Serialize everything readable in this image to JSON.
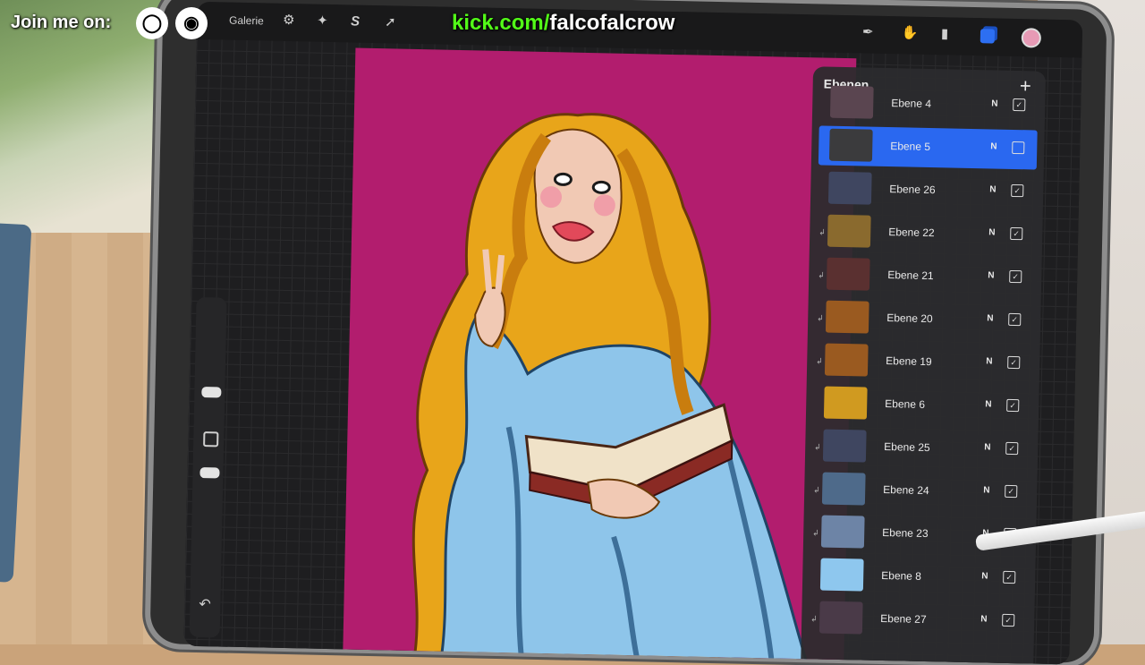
{
  "overlay": {
    "join_text": "Join me on:",
    "instagram_icon": "instagram-icon",
    "discord_icon": "discord-icon",
    "kick_domain": "kick.com/",
    "kick_user": "falcofalcrow",
    "accent_green": "#53fc18"
  },
  "toolbar": {
    "gallery_label": "Galerie",
    "actions_icon": "wrench-icon",
    "adjust_icon": "magic-wand-icon",
    "select_icon": "selection-s-icon",
    "transform_icon": "arrow-icon",
    "brush_icon": "brush-icon",
    "smudge_icon": "smudge-icon",
    "eraser_icon": "eraser-icon",
    "layers_icon": "layers-icon",
    "color_swatch": "#e79ab5"
  },
  "sidebar": {
    "modify_icon": "square-icon",
    "undo_icon": "undo-icon"
  },
  "layers_panel": {
    "title": "Ebenen",
    "add_icon": "plus-icon",
    "layers": [
      {
        "name": "Ebene 4",
        "mode": "N",
        "visible": true,
        "active": false,
        "clipped": false,
        "thumb_color": "#5a4550"
      },
      {
        "name": "Ebene 5",
        "mode": "N",
        "visible": false,
        "active": true,
        "clipped": false,
        "thumb_color": "#3b3b3d"
      },
      {
        "name": "Ebene 26",
        "mode": "N",
        "visible": true,
        "active": false,
        "clipped": false,
        "thumb_color": "#3f4660"
      },
      {
        "name": "Ebene 22",
        "mode": "N",
        "visible": true,
        "active": false,
        "clipped": true,
        "thumb_color": "#8a6a2e"
      },
      {
        "name": "Ebene 21",
        "mode": "N",
        "visible": true,
        "active": false,
        "clipped": true,
        "thumb_color": "#5a3030"
      },
      {
        "name": "Ebene 20",
        "mode": "N",
        "visible": true,
        "active": false,
        "clipped": true,
        "thumb_color": "#9a5a20"
      },
      {
        "name": "Ebene 19",
        "mode": "N",
        "visible": true,
        "active": false,
        "clipped": true,
        "thumb_color": "#9a5a20"
      },
      {
        "name": "Ebene 6",
        "mode": "N",
        "visible": true,
        "active": false,
        "clipped": false,
        "thumb_color": "#d09a20"
      },
      {
        "name": "Ebene 25",
        "mode": "N",
        "visible": true,
        "active": false,
        "clipped": true,
        "thumb_color": "#3f4660"
      },
      {
        "name": "Ebene 24",
        "mode": "N",
        "visible": true,
        "active": false,
        "clipped": true,
        "thumb_color": "#4e6a8a"
      },
      {
        "name": "Ebene 23",
        "mode": "N",
        "visible": true,
        "active": false,
        "clipped": true,
        "thumb_color": "#6d84a6"
      },
      {
        "name": "Ebene 8",
        "mode": "N",
        "visible": true,
        "active": false,
        "clipped": false,
        "thumb_color": "#8ec7ee"
      },
      {
        "name": "Ebene 27",
        "mode": "N",
        "visible": true,
        "active": false,
        "clipped": true,
        "thumb_color": "#4a3a48"
      }
    ]
  }
}
